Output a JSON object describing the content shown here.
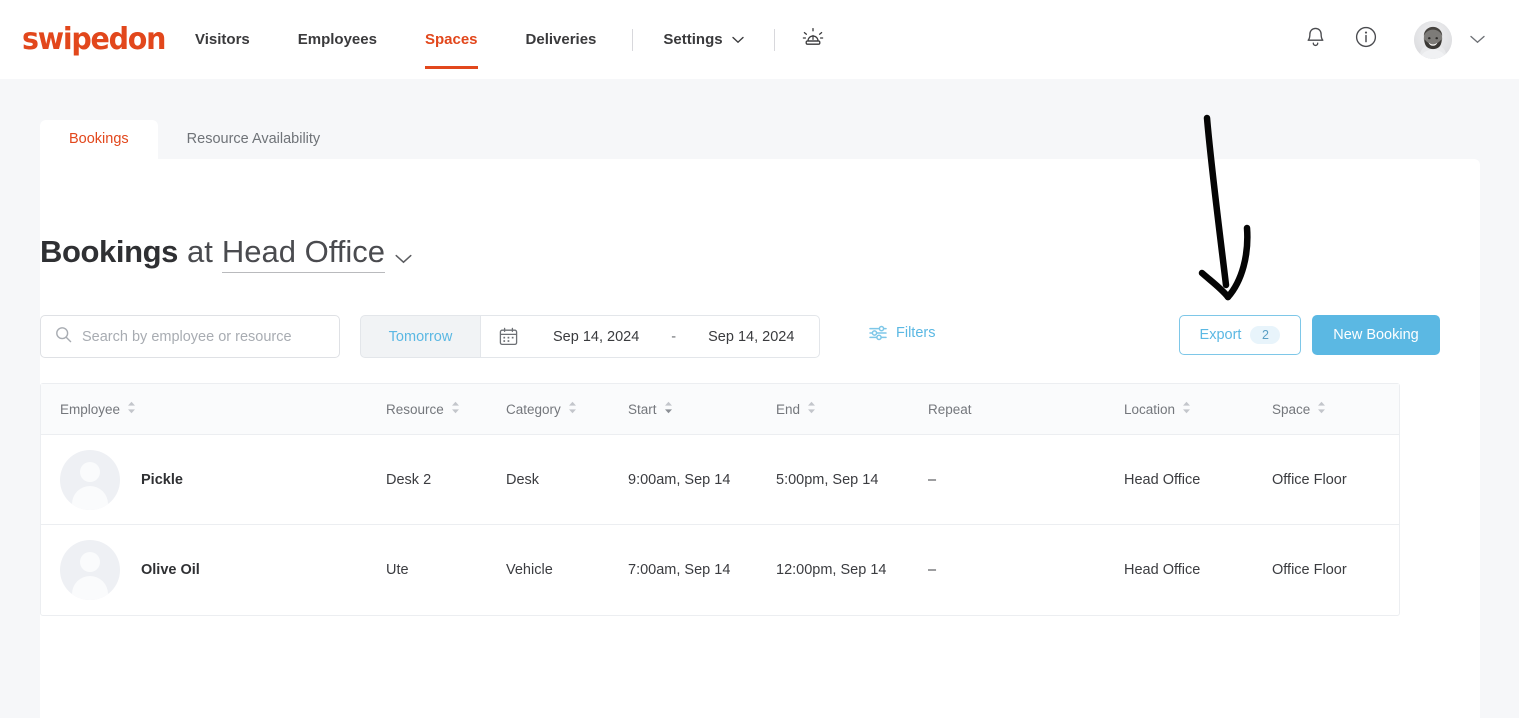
{
  "brand": {
    "logo_text": "swipedon",
    "accent": "#e2471c",
    "blue": "#5bb8e3"
  },
  "topnav": {
    "links": [
      {
        "label": "Visitors",
        "active": false
      },
      {
        "label": "Employees",
        "active": false
      },
      {
        "label": "Spaces",
        "active": true
      },
      {
        "label": "Deliveries",
        "active": false
      }
    ],
    "settings_label": "Settings",
    "icons": {
      "settings_chevron": "chevron-down-icon",
      "siren": "siren-icon",
      "bell": "bell-icon",
      "info": "info-circle-icon",
      "account_chevron": "chevron-down-icon",
      "avatar": "user-avatar"
    }
  },
  "tabs": [
    {
      "label": "Bookings",
      "active": true
    },
    {
      "label": "Resource Availability",
      "active": false
    }
  ],
  "title": {
    "main": "Bookings",
    "connector": "at",
    "location": "Head Office",
    "chevron": "chevron-down-icon"
  },
  "toolbar": {
    "search_placeholder": "Search by employee or resource",
    "search_value": "",
    "search_icon": "search-icon",
    "quick_range": "Tomorrow",
    "calendar_icon": "calendar-icon",
    "date_start": "Sep 14, 2024",
    "date_separator": "-",
    "date_end": "Sep 14, 2024",
    "filters_label": "Filters",
    "filters_icon": "sliders-icon",
    "export_label": "Export",
    "export_count": "2",
    "new_booking_label": "New Booking"
  },
  "table": {
    "columns": [
      {
        "label": "Employee",
        "sortable": true
      },
      {
        "label": "Resource",
        "sortable": true
      },
      {
        "label": "Category",
        "sortable": true
      },
      {
        "label": "Start",
        "sortable": true
      },
      {
        "label": "End",
        "sortable": true
      },
      {
        "label": "Repeat",
        "sortable": false
      },
      {
        "label": "Location",
        "sortable": true
      },
      {
        "label": "Space",
        "sortable": true
      }
    ],
    "rows": [
      {
        "employee": "Pickle",
        "resource": "Desk 2",
        "category": "Desk",
        "start": "9:00am, Sep 14",
        "end": "5:00pm, Sep 14",
        "repeat": "–",
        "location": "Head Office",
        "space": "Office Floor"
      },
      {
        "employee": "Olive Oil",
        "resource": "Ute",
        "category": "Vehicle",
        "start": "7:00am, Sep 14",
        "end": "12:00pm, Sep 14",
        "repeat": "–",
        "location": "Head Office",
        "space": "Office Floor"
      }
    ]
  },
  "annotation": {
    "type": "arrow-down-icon",
    "color": "#000000"
  }
}
